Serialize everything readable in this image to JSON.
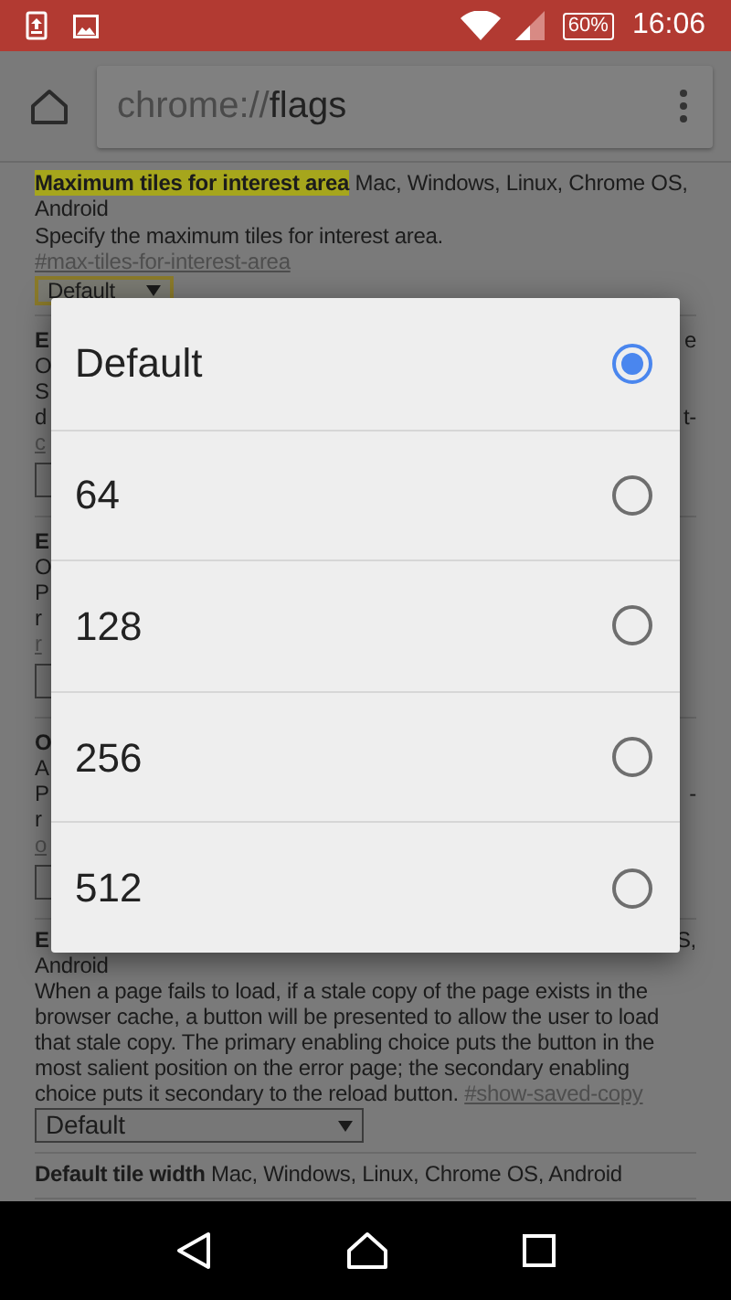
{
  "status_bar": {
    "battery": "60%",
    "time": "16:06"
  },
  "toolbar": {
    "url_scheme": "chrome://",
    "url_host": "flags"
  },
  "sections": [
    {
      "kind": "full",
      "title": "Maximum tiles for interest area",
      "highlighted": true,
      "platforms": "Mac, Windows, Linux, Chrome OS, Android",
      "description": "Specify the maximum tiles for interest area.",
      "link": "#max-tiles-for-interest-area",
      "select": "Default",
      "focused": true
    },
    {
      "kind": "covered",
      "lines": [
        {
          "kind": "title",
          "left": "E",
          "right": "e"
        },
        {
          "kind": "text",
          "left": "O"
        },
        {
          "kind": "text",
          "left": "S"
        },
        {
          "kind": "text",
          "left": "d",
          "right": "t-"
        },
        {
          "kind": "link",
          "left": "c"
        }
      ]
    },
    {
      "kind": "covered",
      "lines": [
        {
          "kind": "title",
          "left": "E"
        },
        {
          "kind": "text",
          "left": "O"
        },
        {
          "kind": "text",
          "left": "P"
        },
        {
          "kind": "text",
          "left": "r"
        },
        {
          "kind": "link",
          "left": "r"
        }
      ]
    },
    {
      "kind": "covered",
      "lines": [
        {
          "kind": "title",
          "left": "O"
        },
        {
          "kind": "text",
          "left": "A"
        },
        {
          "kind": "text",
          "left": "P",
          "right": "-"
        },
        {
          "kind": "text",
          "left": "r"
        },
        {
          "kind": "link",
          "left": "o"
        }
      ]
    },
    {
      "kind": "partial",
      "title_left": "E",
      "title_right": "S,",
      "platforms": "Android",
      "description": "When a page fails to load, if a stale copy of the page exists in the browser cache, a button will be presented to allow the user to load that stale copy. The primary enabling choice puts the button in the most salient position on the error page; the secondary enabling choice puts it secondary to the reload button.",
      "link": "#show-saved-copy",
      "select": "Default",
      "focused": false
    },
    {
      "kind": "full",
      "title": "Default tile width",
      "highlighted": false,
      "platforms": "Mac, Windows, Linux, Chrome OS, Android"
    }
  ],
  "dialog": {
    "options": [
      {
        "label": "Default",
        "selected": true
      },
      {
        "label": "64",
        "selected": false
      },
      {
        "label": "128",
        "selected": false
      },
      {
        "label": "256",
        "selected": false
      },
      {
        "label": "512",
        "selected": false
      }
    ]
  }
}
